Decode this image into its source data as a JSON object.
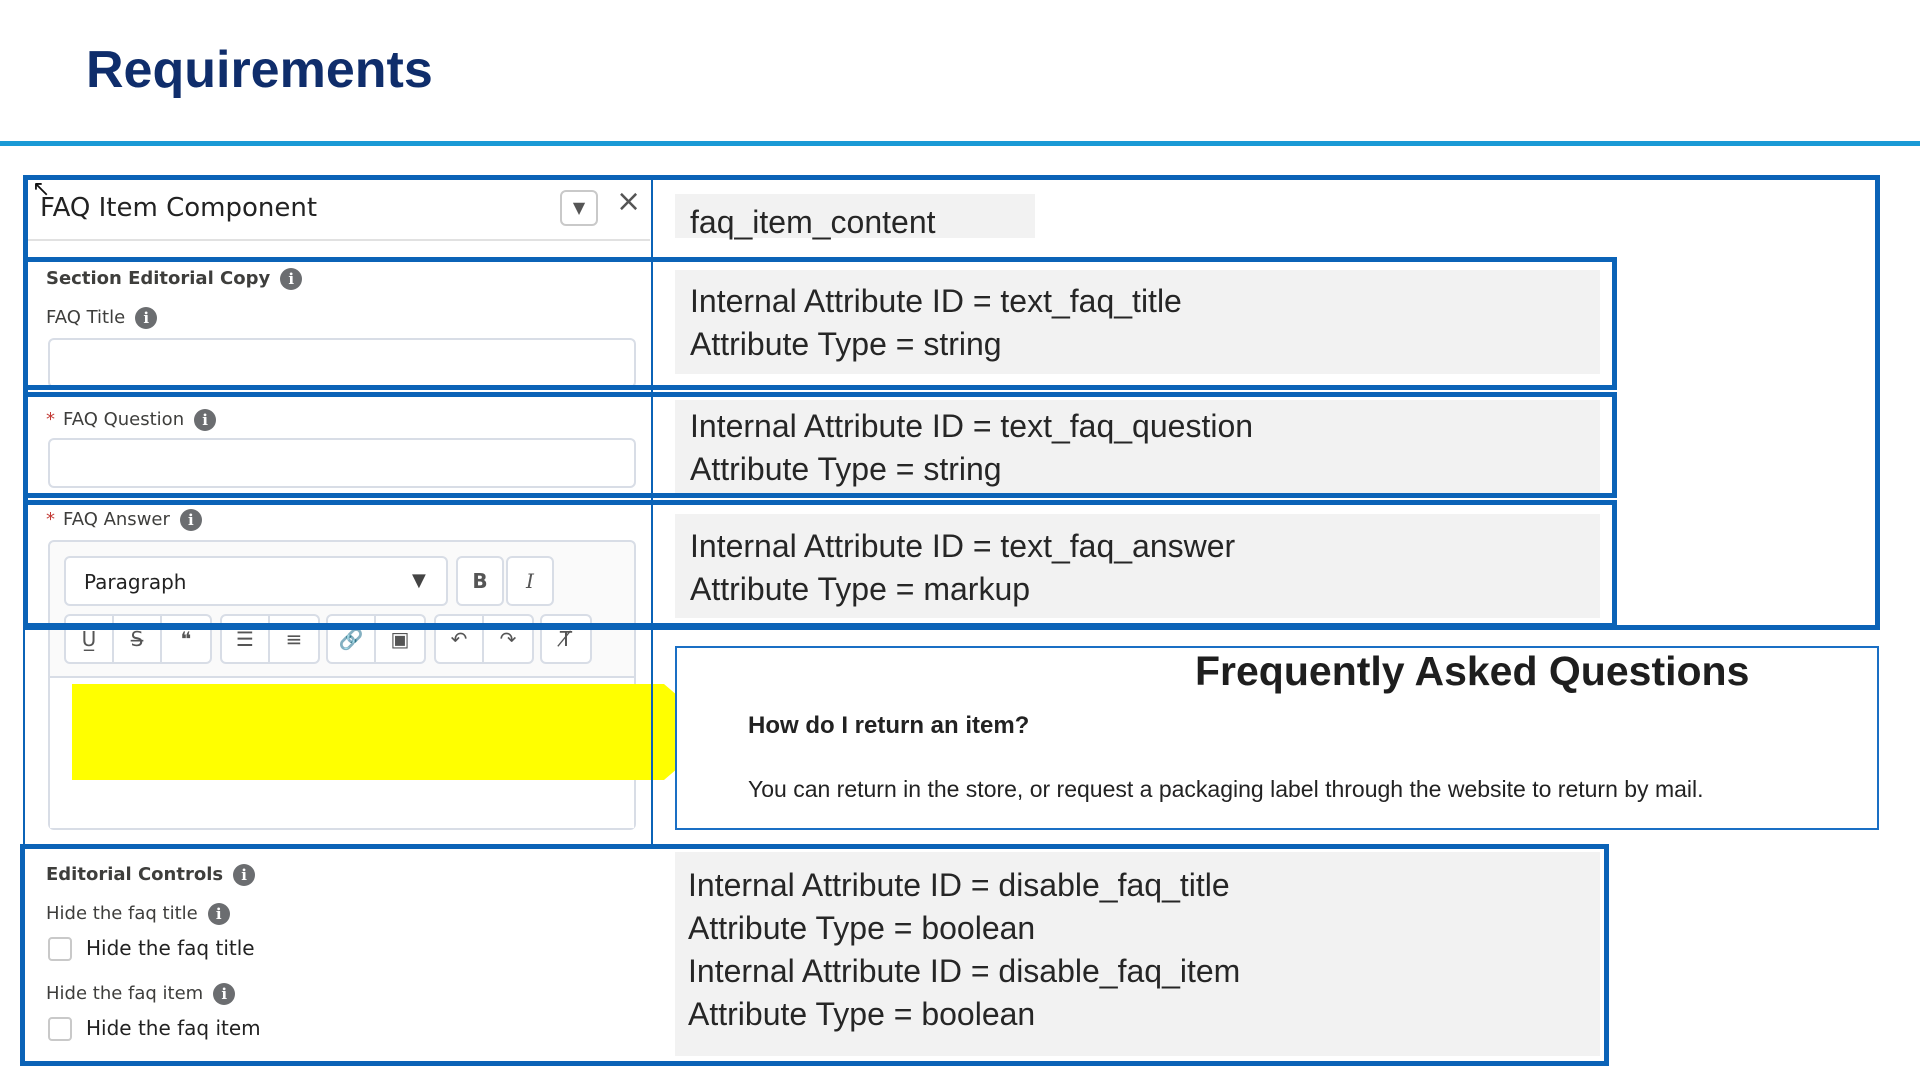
{
  "slide": {
    "title": "Requirements"
  },
  "panel": {
    "title": "FAQ Item Component",
    "section_editorial_copy": "Section Editorial Copy",
    "faq_title_label": "FAQ Title",
    "faq_question_label": "FAQ Question",
    "faq_answer_label": "FAQ Answer",
    "required_mark": "*",
    "info_glyph": "i",
    "editor": {
      "format_selected": "Paragraph",
      "bold": "B",
      "italic": "I"
    },
    "editorial_controls": "Editorial Controls",
    "hide_title_label": "Hide the faq title",
    "hide_title_checkbox": "Hide the faq title",
    "hide_item_label": "Hide the faq item",
    "hide_item_checkbox": "Hide the faq item"
  },
  "notes": {
    "component_id": "faq_item_content",
    "title_id": "Internal Attribute ID = text_faq_title",
    "title_type": "Attribute Type = string",
    "question_id": "Internal Attribute ID = text_faq_question",
    "question_type": "Attribute Type = string",
    "answer_id": "Internal Attribute ID = text_faq_answer",
    "answer_type": "Attribute Type = markup",
    "disable_title_id": "Internal Attribute ID = disable_faq_title",
    "disable_title_type": "Attribute Type = boolean",
    "disable_item_id": "Internal Attribute ID = disable_faq_item",
    "disable_item_type": "Attribute Type = boolean"
  },
  "preview": {
    "heading": "Frequently Asked Questions",
    "question": "How do I return an item?",
    "answer": "You can return in the store, or request a packaging label through the website to return by mail."
  },
  "colors": {
    "title": "#0f2d6b",
    "rule": "#1a9ad6",
    "frame": "#0b63b7",
    "arrow": "#ffff00",
    "note_bg": "#f2f2f2"
  }
}
